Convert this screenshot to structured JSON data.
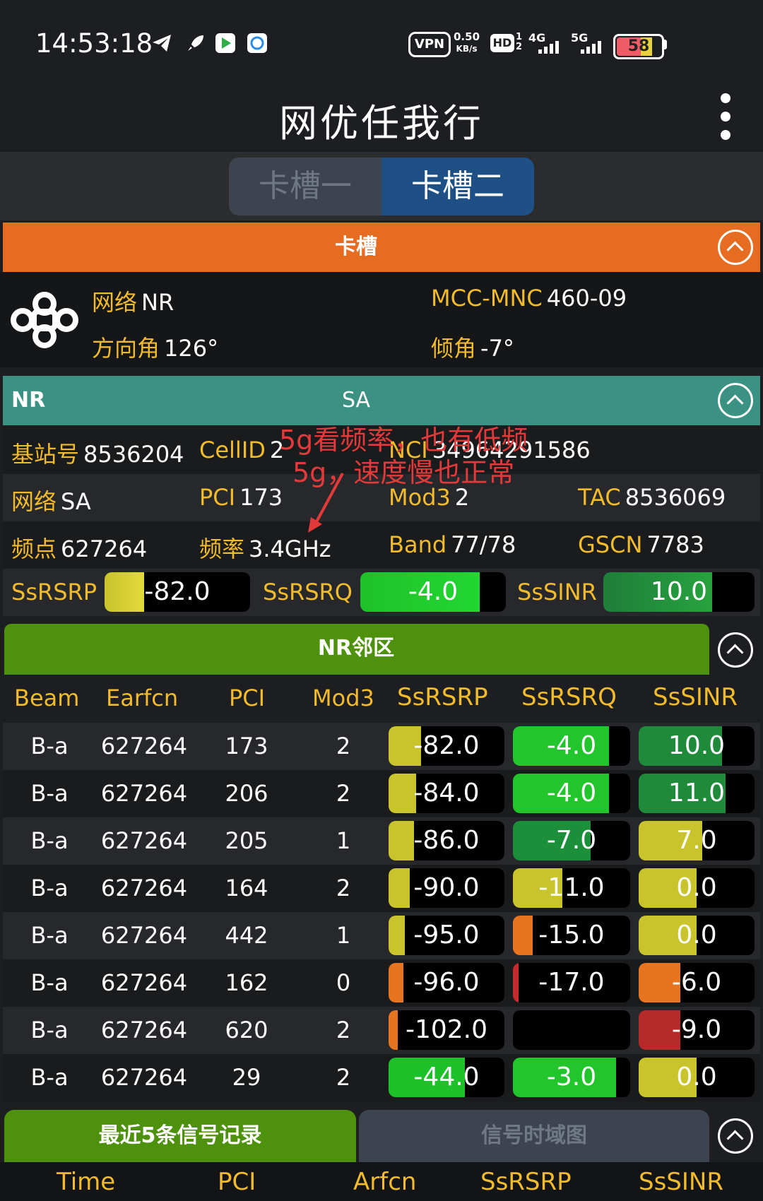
{
  "status_bar": {
    "time": "14:53:18",
    "vpn": "VPN",
    "speed_value": "0.50",
    "speed_unit": "KB/s",
    "hd": "HD",
    "hd_sub": "1 2",
    "net1": "4G",
    "net2": "5G",
    "battery": "58",
    "icons": [
      "telegram-icon",
      "rocket-icon",
      "play-app-icon",
      "browser-app-icon"
    ]
  },
  "app": {
    "title": "网优任我行"
  },
  "sim_tabs": [
    "卡槽一",
    "卡槽二"
  ],
  "sim_section": {
    "title": "卡槽",
    "network_label": "网络",
    "network_value": "NR",
    "mccmnc_label": "MCC-MNC",
    "mccmnc_value": "460-09",
    "azimuth_label": "方向角",
    "azimuth_value": "126°",
    "tilt_label": "倾角",
    "tilt_value": "-7°"
  },
  "nr_section": {
    "title_left": "NR",
    "title_center": "SA",
    "rows": [
      [
        {
          "k": "基站号",
          "v": "8536204"
        },
        {
          "k": "CellID",
          "v": "2"
        },
        {
          "k": "NCI",
          "v": "34964291586"
        }
      ],
      [
        {
          "k": "网络",
          "v": "SA"
        },
        {
          "k": "PCI",
          "v": "173"
        },
        {
          "k": "Mod3",
          "v": "2"
        },
        {
          "k": "TAC",
          "v": "8536069"
        }
      ],
      [
        {
          "k": "频点",
          "v": "627264"
        },
        {
          "k": "频率",
          "v": "3.4GHz"
        },
        {
          "k": "Band",
          "v": "77/78"
        },
        {
          "k": "GSCN",
          "v": "7783"
        }
      ]
    ],
    "metrics": [
      {
        "label": "SsRSRP",
        "value": "-82.0",
        "fill": 0.27,
        "color": "#c9c32c",
        "color2": "#e2da3c"
      },
      {
        "label": "SsRSRQ",
        "value": "-4.0",
        "fill": 0.82,
        "color": "#1ec12a",
        "color2": "#22d732"
      },
      {
        "label": "SsSINR",
        "value": "10.0",
        "fill": 0.72,
        "color": "#1f7d3a",
        "color2": "#27a33e"
      }
    ]
  },
  "annotation": {
    "line1": "5g看频率，也有低频",
    "line2": "5g，速度慢也正常"
  },
  "neighbor_section": {
    "title": "NR邻区",
    "headers": [
      "Beam",
      "Earfcn",
      "PCI",
      "Mod3",
      "SsRSRP",
      "SsRSRQ",
      "SsSINR"
    ],
    "rows": [
      {
        "beam": "B-a",
        "earfcn": "627264",
        "pci": "173",
        "mod3": "2",
        "rsrp": "-82.0",
        "rsrp_f": 0.28,
        "rsrp_c": "#c9c32c",
        "rsrq": "-4.0",
        "rsrq_f": 0.82,
        "rsrq_c": "#22c52c",
        "sinr": "10.0",
        "sinr_f": 0.72,
        "sinr_c": "#1f8a3a"
      },
      {
        "beam": "B-a",
        "earfcn": "627264",
        "pci": "206",
        "mod3": "2",
        "rsrp": "-84.0",
        "rsrp_f": 0.24,
        "rsrp_c": "#c9c32c",
        "rsrq": "-4.0",
        "rsrq_f": 0.82,
        "rsrq_c": "#22c52c",
        "sinr": "11.0",
        "sinr_f": 0.75,
        "sinr_c": "#1f8a3a"
      },
      {
        "beam": "B-a",
        "earfcn": "627264",
        "pci": "205",
        "mod3": "1",
        "rsrp": "-86.0",
        "rsrp_f": 0.22,
        "rsrp_c": "#c9c32c",
        "rsrq": "-7.0",
        "rsrq_f": 0.66,
        "rsrq_c": "#1c8f3a",
        "sinr": "7.0",
        "sinr_f": 0.55,
        "sinr_c": "#c9c32c"
      },
      {
        "beam": "B-a",
        "earfcn": "627264",
        "pci": "164",
        "mod3": "2",
        "rsrp": "-90.0",
        "rsrp_f": 0.18,
        "rsrp_c": "#c9c32c",
        "rsrq": "-11.0",
        "rsrq_f": 0.42,
        "rsrq_c": "#c9c32c",
        "sinr": "0.0",
        "sinr_f": 0.5,
        "sinr_c": "#c9c32c"
      },
      {
        "beam": "B-a",
        "earfcn": "627264",
        "pci": "442",
        "mod3": "1",
        "rsrp": "-95.0",
        "rsrp_f": 0.14,
        "rsrp_c": "#c9c32c",
        "rsrq": "-15.0",
        "rsrq_f": 0.17,
        "rsrq_c": "#e7751f",
        "sinr": "0.0",
        "sinr_f": 0.5,
        "sinr_c": "#c9c32c"
      },
      {
        "beam": "B-a",
        "earfcn": "627264",
        "pci": "162",
        "mod3": "0",
        "rsrp": "-96.0",
        "rsrp_f": 0.13,
        "rsrp_c": "#e7751f",
        "rsrq": "-17.0",
        "rsrq_f": 0.05,
        "rsrq_c": "#c62a2a",
        "sinr": "-6.0",
        "sinr_f": 0.36,
        "sinr_c": "#e7751f"
      },
      {
        "beam": "B-a",
        "earfcn": "627264",
        "pci": "620",
        "mod3": "2",
        "rsrp": "-102.0",
        "rsrp_f": 0.08,
        "rsrp_c": "#e7751f",
        "rsrq": "",
        "rsrq_f": 0.0,
        "rsrq_c": "#000000",
        "sinr": "-9.0",
        "sinr_f": 0.36,
        "sinr_c": "#b62a2a"
      },
      {
        "beam": "B-a",
        "earfcn": "627264",
        "pci": "29",
        "mod3": "2",
        "rsrp": "-44.0",
        "rsrp_f": 0.66,
        "rsrp_c": "#1ec12a",
        "rsrq": "-3.0",
        "rsrq_f": 0.88,
        "rsrq_c": "#22c52c",
        "sinr": "0.0",
        "sinr_f": 0.5,
        "sinr_c": "#c9c32c"
      }
    ]
  },
  "bottom": {
    "tab_active": "最近5条信号记录",
    "tab_inactive": "信号时域图",
    "headers": [
      "Time",
      "PCI",
      "Arfcn",
      "SsRSRP",
      "SsSINR"
    ]
  }
}
